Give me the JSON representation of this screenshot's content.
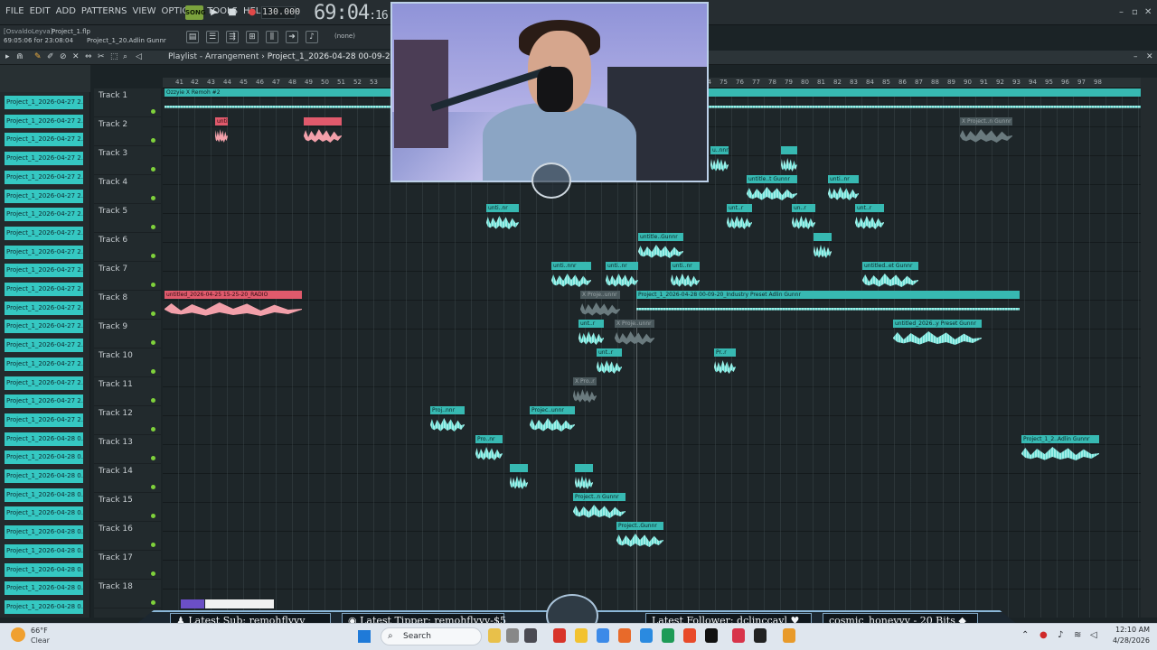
{
  "menu": [
    "FILE",
    "EDIT",
    "ADD",
    "PATTERNS",
    "VIEW",
    "OPTIONS",
    "TOOLS",
    "HELP"
  ],
  "transport": {
    "song_badge": "SONG",
    "tempo": "130.000",
    "time_main": "69:04",
    "time_sub": ":16"
  },
  "info": {
    "user": "[OsvaldoLeyva]",
    "project": "Project_1.flp",
    "time_line": "69:05:06 for 23:08:04",
    "file_line": "Project_1_20.Adlin Gunnr",
    "none_select": "(none)"
  },
  "playlist": {
    "label": "Playlist - Arrangement",
    "sep": "›",
    "pattern": "Project_1_2026-04-28 00-09-20_Ind"
  },
  "ruler": [
    "41",
    "42",
    "43",
    "44",
    "45",
    "46",
    "47",
    "48",
    "49",
    "50",
    "51",
    "52",
    "53",
    "74",
    "75",
    "76",
    "77",
    "78",
    "79",
    "80",
    "81",
    "82",
    "83",
    "84",
    "85",
    "86",
    "87",
    "88",
    "89",
    "90",
    "91",
    "92",
    "93",
    "94",
    "95",
    "96",
    "97",
    "98"
  ],
  "browser_items": [
    "Project_1_2026-04-27 2...",
    "Project_1_2026-04-27 2...",
    "Project_1_2026-04-27 2...",
    "Project_1_2026-04-27 2...",
    "Project_1_2026-04-27 2...",
    "Project_1_2026-04-27 2...",
    "Project_1_2026-04-27 2...",
    "Project_1_2026-04-27 2...",
    "Project_1_2026-04-27 2...",
    "Project_1_2026-04-27 2...",
    "Project_1_2026-04-27 2...",
    "Project_1_2026-04-27 2...",
    "Project_1_2026-04-27 2...",
    "Project_1_2026-04-27 2...",
    "Project_1_2026-04-27 2...",
    "Project_1_2026-04-27 2...",
    "Project_1_2026-04-27 2...",
    "Project_1_2026-04-27 2...",
    "Project_1_2026-04-28 0...",
    "Project_1_2026-04-28 0...",
    "Project_1_2026-04-28 0...",
    "Project_1_2026-04-28 0...",
    "Project_1_2026-04-28 0...",
    "Project_1_2026-04-28 0...",
    "Project_1_2026-04-28 0...",
    "Project_1_2026-04-28 0...",
    "Project_1_2026-04-28 0...",
    "Project_1_2026-04-28 0..."
  ],
  "tracks": [
    "Track 1",
    "Track 2",
    "Track 3",
    "Track 4",
    "Track 5",
    "Track 6",
    "Track 7",
    "Track 8",
    "Track 9",
    "Track 10",
    "Track 11",
    "Track 12",
    "Track 13",
    "Track 14",
    "Track 15",
    "Track 16",
    "Track 17",
    "Track 18"
  ],
  "clips": [
    {
      "label": "Ozzyie X Remoh #2"
    },
    {
      "label": "untit..ADIO"
    },
    {
      "label": ""
    },
    {
      "label": "X Project..n Gunnr"
    },
    {
      "label": "u..nnr"
    },
    {
      "label": ""
    },
    {
      "label": "untitle..t Gunnr"
    },
    {
      "label": "unti..nr"
    },
    {
      "label": "unti..nr"
    },
    {
      "label": "unt..r"
    },
    {
      "label": "un..r"
    },
    {
      "label": "unt..r"
    },
    {
      "label": "untitle..Gunnr"
    },
    {
      "label": ""
    },
    {
      "label": "unti..nnr"
    },
    {
      "label": "unti..nr"
    },
    {
      "label": "unti..nr"
    },
    {
      "label": "untitled..et Gunnr"
    },
    {
      "label": "untitled_2026-04-25 15-25-20_RADIO"
    },
    {
      "label": "X Proje..unnr"
    },
    {
      "label": "Project_1_2026-04-28 00-09-20_Industry Preset Adlin Gunnr"
    },
    {
      "label": "unt..r"
    },
    {
      "label": "X Proje..unnr"
    },
    {
      "label": "untitled_2026..y Preset Gunnr"
    },
    {
      "label": "unt..r"
    },
    {
      "label": "Pr..r"
    },
    {
      "label": "X Pro..r"
    },
    {
      "label": "Proj..nnr"
    },
    {
      "label": "Projec..unnr"
    },
    {
      "label": "Pro..nr"
    },
    {
      "label": "Project_1_2..Adlin Gunnr"
    },
    {
      "label": ""
    },
    {
      "label": ""
    },
    {
      "label": "Project..n Gunnr"
    },
    {
      "label": "Project..Gunnr"
    }
  ],
  "stream": {
    "latest_sub": "Latest Sub: remohflyyy",
    "latest_tipper": "Latest Tipper: remohflyyy-$5",
    "latest_follower": "Latest Follower: dclinccayl",
    "bits": "cosmic_honeyyy - 20 Bits"
  },
  "taskbar": {
    "temp": "66°F",
    "condition": "Clear",
    "search": "Search",
    "time": "12:10 AM",
    "date": "4/28/2026"
  },
  "colors": {
    "clip": "#37b9b2",
    "clip_red": "#e05a6c",
    "browser_item": "#35c8c2"
  }
}
